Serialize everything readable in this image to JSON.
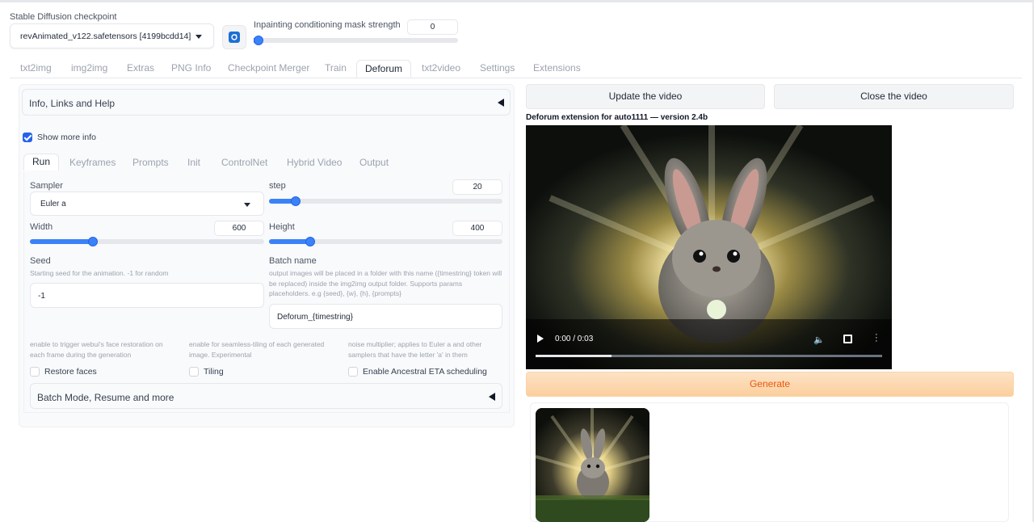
{
  "checkpoint": {
    "label": "Stable Diffusion checkpoint",
    "value": "revAnimated_v122.safetensors [4199bcdd14]"
  },
  "inpaint": {
    "label": "Inpainting conditioning mask strength",
    "value": "0",
    "fraction": 0.0
  },
  "main_tabs": [
    "txt2img",
    "img2img",
    "Extras",
    "PNG Info",
    "Checkpoint Merger",
    "Train",
    "Deforum",
    "txt2video",
    "Settings",
    "Extensions"
  ],
  "active_main_tab": "Deforum",
  "left": {
    "info_accordion": "Info, Links and Help",
    "show_more_info": "Show more info",
    "sub_tabs": [
      "Run",
      "Keyframes",
      "Prompts",
      "Init",
      "ControlNet",
      "Hybrid Video",
      "Output"
    ],
    "active_sub_tab": "Run",
    "sampler": {
      "label": "Sampler",
      "value": "Euler a"
    },
    "step": {
      "label": "step",
      "value": "20",
      "fraction": 0.11
    },
    "width": {
      "label": "Width",
      "value": "600",
      "fraction": 0.27
    },
    "height": {
      "label": "Height",
      "value": "400",
      "fraction": 0.17
    },
    "seed": {
      "label": "Seed",
      "hint": "Starting seed for the animation. -1 for random",
      "value": "-1"
    },
    "batch_name": {
      "label": "Batch name",
      "hint": "output images will be placed in a folder with this name ({timestring} token will be replaced) inside the img2img output folder. Supports params placeholders. e.g {seed}, {w}, {h}, {prompts}",
      "value": "Deforum_{timestring}"
    },
    "restore_faces": {
      "hint": "enable to trigger webui's face restoration on each frame during the generation",
      "label": "Restore faces"
    },
    "tiling": {
      "hint": "enable for seamless-tiling of each generated image. Experimental",
      "label": "Tiling"
    },
    "ancestral": {
      "hint": "noise multiplier; applies to Euler a and other samplers that have the letter 'a' in them",
      "label": "Enable Ancestral ETA scheduling"
    },
    "batch_accordion": "Batch Mode, Resume and more"
  },
  "right": {
    "update_button": "Update the video",
    "close_button": "Close the video",
    "version_text": "Deforum extension for auto1111 — version 2.4b",
    "video_time": "0:00 / 0:03",
    "video_progress": 0.22,
    "generate_button": "Generate"
  },
  "colors": {
    "accent": "#3b82f6",
    "generate_text": "#ea580c",
    "generate_bg": "#fcd9b0"
  }
}
